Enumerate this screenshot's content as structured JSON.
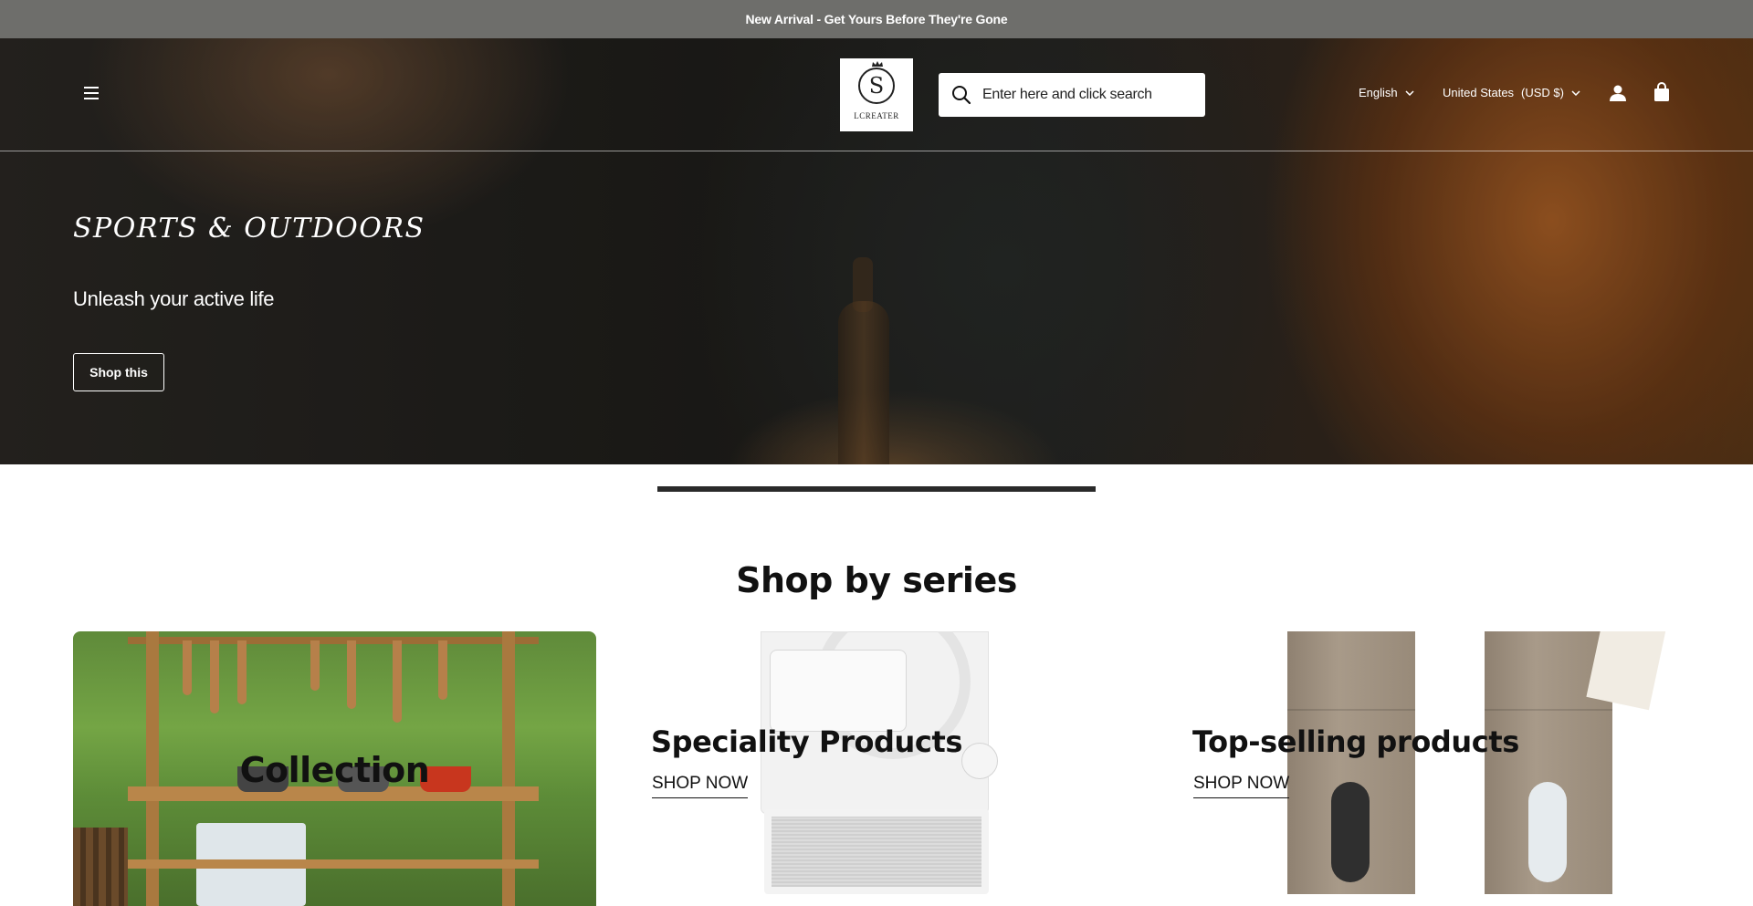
{
  "announcement": {
    "text": "New Arrival - Get Yours Before They're Gone"
  },
  "header": {
    "logo_text": "LCREATER",
    "logo_letter": "S",
    "search": {
      "placeholder": "Enter here and click search",
      "value": ""
    },
    "language": "English",
    "country": "United States",
    "currency": "(USD $)"
  },
  "hero": {
    "title": "SPORTS & OUTDOORS",
    "subtitle": "Unleash your active life",
    "button": "Shop this",
    "slide_progress": 1.0
  },
  "series": {
    "title": "Shop by series",
    "cards": [
      {
        "label": "Collection"
      },
      {
        "label": "Speciality Products",
        "link": "SHOP NOW"
      },
      {
        "label": "Top-selling products",
        "link": "SHOP NOW"
      }
    ]
  },
  "colors": {
    "announcement_bg": "#6e6e6b",
    "slider_fill": "#2a2a2a",
    "text_dark": "#111111"
  }
}
